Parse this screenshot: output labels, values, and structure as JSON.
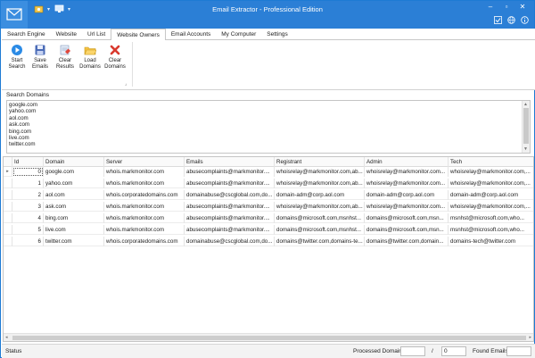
{
  "window": {
    "title": "Email Extractor - Professional Edition"
  },
  "tabs": [
    {
      "label": "Search Engine"
    },
    {
      "label": "Website"
    },
    {
      "label": "Url List"
    },
    {
      "label": "Website Owners"
    },
    {
      "label": "Email Accounts"
    },
    {
      "label": "My Computer"
    },
    {
      "label": "Settings"
    }
  ],
  "active_tab": "Website Owners",
  "ribbon": {
    "start_search": {
      "line1": "Start",
      "line2": "Search",
      "icon": "play-icon"
    },
    "save_emails": {
      "line1": "Save",
      "line2": "Emails",
      "icon": "floppy-icon"
    },
    "clear_results": {
      "line1": "Clear",
      "line2": "Results",
      "icon": "eraser-icon"
    },
    "load_domains": {
      "line1": "Load",
      "line2": "Domains",
      "icon": "folder-icon"
    },
    "clear_domains": {
      "line1": "Clear",
      "line2": "Domains",
      "icon": "x-icon"
    }
  },
  "search_domains": {
    "label": "Search Domains",
    "lines": [
      "google.com",
      "yahoo.com",
      "aol.com",
      "ask.com",
      "bing.com",
      "live.com",
      "twitter.com"
    ]
  },
  "grid": {
    "columns": [
      "Id",
      "Domain",
      "Server",
      "Emails",
      "Registrant",
      "Admin",
      "Tech"
    ],
    "rows": [
      {
        "id": "0",
        "domain": "google.com",
        "server": "whois.markmonitor.com",
        "emails": "abusecomplaints@markmonitor....",
        "registrant": "whoisrelay@markmonitor.com,ab...",
        "admin": "whoisrelay@markmonitor.com...",
        "tech": "whoisrelay@markmonitor.com,..."
      },
      {
        "id": "1",
        "domain": "yahoo.com",
        "server": "whois.markmonitor.com",
        "emails": "abusecomplaints@markmonitor....",
        "registrant": "whoisrelay@markmonitor.com,ab...",
        "admin": "whoisrelay@markmonitor.com...",
        "tech": "whoisrelay@markmonitor.com,..."
      },
      {
        "id": "2",
        "domain": "aol.com",
        "server": "whois.corporatedomains.com",
        "emails": "domainabuse@cscglobal.com,do...",
        "registrant": "domain-adm@corp.aol.com",
        "admin": "domain-adm@corp.aol.com",
        "tech": "domain-adm@corp.aol.com"
      },
      {
        "id": "3",
        "domain": "ask.com",
        "server": "whois.markmonitor.com",
        "emails": "abusecomplaints@markmonitor....",
        "registrant": "whoisrelay@markmonitor.com,ab...",
        "admin": "whoisrelay@markmonitor.com...",
        "tech": "whoisrelay@markmonitor.com,..."
      },
      {
        "id": "4",
        "domain": "bing.com",
        "server": "whois.markmonitor.com",
        "emails": "abusecomplaints@markmonitor....",
        "registrant": "domains@microsoft.com,msnhst...",
        "admin": "domains@microsoft.com,msn...",
        "tech": "msnhst@microsoft.com,who..."
      },
      {
        "id": "5",
        "domain": "live.com",
        "server": "whois.markmonitor.com",
        "emails": "abusecomplaints@markmonitor....",
        "registrant": "domains@microsoft.com,msnhst...",
        "admin": "domains@microsoft.com,msn...",
        "tech": "msnhst@microsoft.com,who..."
      },
      {
        "id": "6",
        "domain": "twitter.com",
        "server": "whois.corporatedomains.com",
        "emails": "domainabuse@cscglobal.com,do...",
        "registrant": "domains@twitter.com,domains-te...",
        "admin": "domains@twitter.com,domain...",
        "tech": "domains-tech@twitter.com"
      }
    ]
  },
  "status": {
    "text": "Status",
    "processed_label": "Processed Domains",
    "processed_value": "",
    "slash": "/",
    "total_value": "0",
    "found_label": "Found Emails",
    "found_value": ""
  },
  "colors": {
    "titlebar": "#2b7fd6",
    "accent": "#1e7bd4"
  }
}
